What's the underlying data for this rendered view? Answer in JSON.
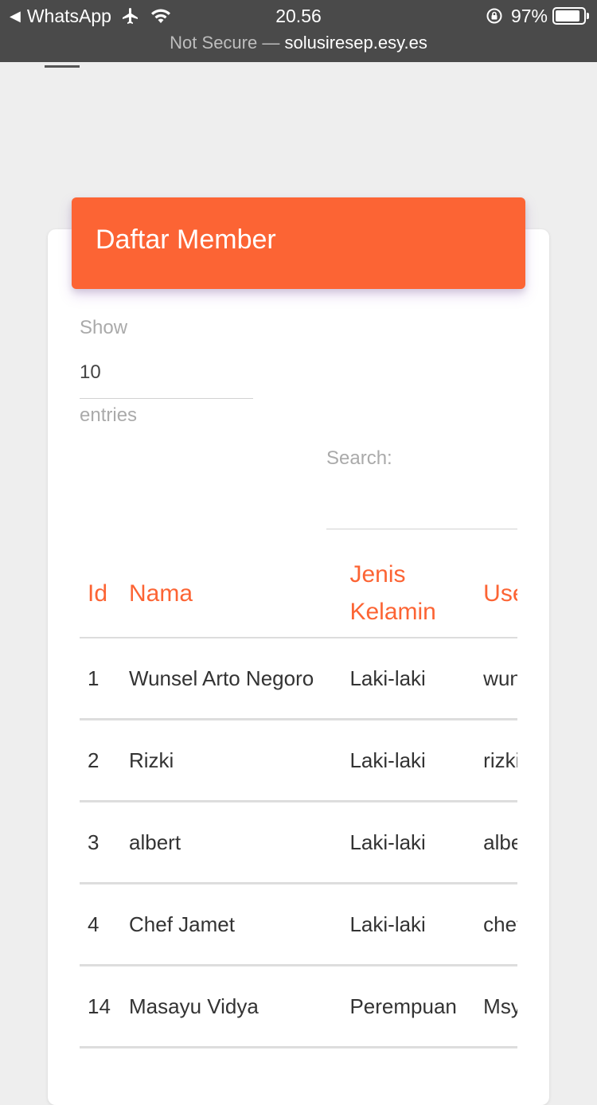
{
  "status_bar": {
    "back_app": "WhatsApp",
    "time": "20.56",
    "battery_percent": "97%",
    "battery_level": 0.97
  },
  "browser": {
    "security": "Not Secure",
    "separator": "—",
    "domain": "solusiresep.esy.es"
  },
  "card": {
    "title": "Daftar Member",
    "header_color": "#fc6434"
  },
  "length_control": {
    "show_label": "Show",
    "value": "10",
    "entries_label": "entries"
  },
  "search": {
    "label": "Search:",
    "value": ""
  },
  "table": {
    "columns": [
      "Id",
      "Nama",
      "Jenis Kelamin",
      "Username"
    ],
    "rows": [
      {
        "id": "1",
        "nama": "Wunsel Arto Negoro",
        "jenis_kelamin": "Laki-laki",
        "username": "wunsel"
      },
      {
        "id": "2",
        "nama": "Rizki",
        "jenis_kelamin": "Laki-laki",
        "username": "rizki"
      },
      {
        "id": "3",
        "nama": "albert",
        "jenis_kelamin": "Laki-laki",
        "username": "albert"
      },
      {
        "id": "4",
        "nama": "Chef Jamet",
        "jenis_kelamin": "Laki-laki",
        "username": "chef"
      },
      {
        "id": "14",
        "nama": "Masayu Vidya",
        "jenis_kelamin": "Perempuan",
        "username": "Msy"
      }
    ]
  }
}
